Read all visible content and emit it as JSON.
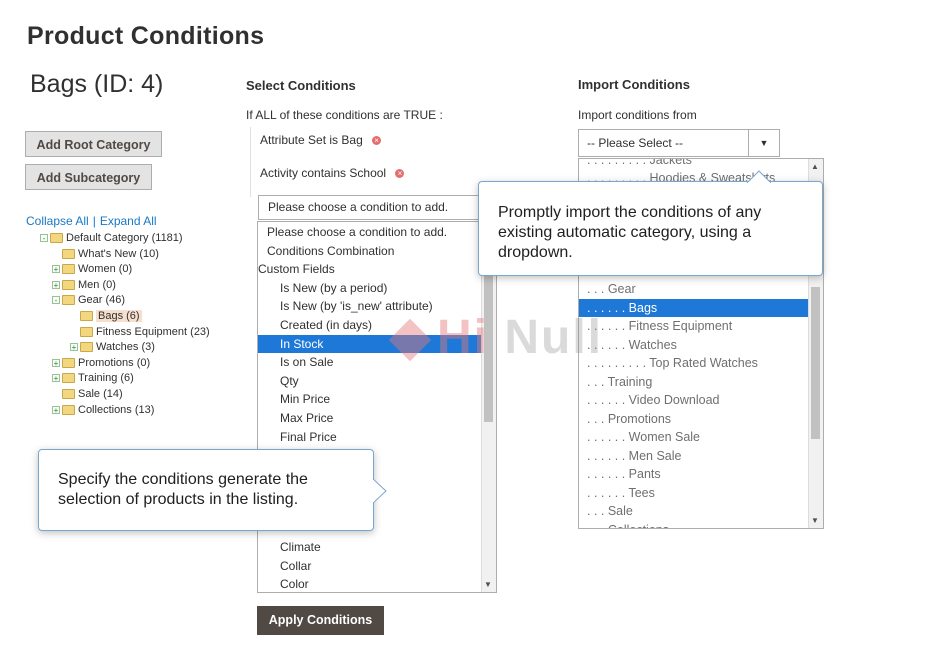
{
  "page": {
    "title": "Product Conditions"
  },
  "category": {
    "heading": "Bags (ID: 4)",
    "add_root_label": "Add Root Category",
    "add_sub_label": "Add Subcategory",
    "collapse_all": "Collapse All",
    "separator": "|",
    "expand_all": "Expand All",
    "tree": [
      {
        "label": "Default Category (1181)",
        "level": 0,
        "toggle": "-",
        "selected": false
      },
      {
        "label": "What's New (10)",
        "level": 1,
        "toggle": "",
        "selected": false
      },
      {
        "label": "Women (0)",
        "level": 1,
        "toggle": "+",
        "selected": false
      },
      {
        "label": "Men (0)",
        "level": 1,
        "toggle": "+",
        "selected": false
      },
      {
        "label": "Gear (46)",
        "level": 1,
        "toggle": "-",
        "selected": false
      },
      {
        "label": "Bags (6)",
        "level": 2,
        "toggle": "",
        "selected": true
      },
      {
        "label": "Fitness Equipment (23)",
        "level": 2,
        "toggle": "",
        "selected": false
      },
      {
        "label": "Watches (3)",
        "level": 2,
        "toggle": "+",
        "selected": false
      },
      {
        "label": "Promotions (0)",
        "level": 1,
        "toggle": "+",
        "selected": false
      },
      {
        "label": "Training (6)",
        "level": 1,
        "toggle": "+",
        "selected": false
      },
      {
        "label": "Sale (14)",
        "level": 1,
        "toggle": "",
        "selected": false
      },
      {
        "label": "Collections (13)",
        "level": 1,
        "toggle": "+",
        "selected": false
      }
    ]
  },
  "conditions": {
    "heading": "Select Conditions",
    "intro_prefix": "If",
    "intro_all": "ALL",
    "intro_mid": "of these conditions are",
    "intro_true": "TRUE",
    "intro_suffix": ":",
    "rule1": {
      "attr": "Attribute Set",
      "op": "is",
      "value": "Bag"
    },
    "rule2": {
      "attr": "Activity",
      "op": "contains",
      "value": "School"
    },
    "select_placeholder": "Please choose a condition to add.",
    "options_top": [
      {
        "label": "Please choose a condition to add.",
        "type": "top"
      },
      {
        "label": "Conditions Combination",
        "type": "top"
      },
      {
        "label": "Custom Fields",
        "type": "group"
      },
      {
        "label": "Is New (by a period)",
        "type": "ind"
      },
      {
        "label": "Is New (by 'is_new' attribute)",
        "type": "ind"
      },
      {
        "label": "Created (in days)",
        "type": "ind"
      },
      {
        "label": "In Stock",
        "type": "ind",
        "hl": true
      },
      {
        "label": "Is on Sale",
        "type": "ind"
      },
      {
        "label": "Qty",
        "type": "ind"
      },
      {
        "label": "Min Price",
        "type": "ind"
      },
      {
        "label": "Max Price",
        "type": "ind"
      },
      {
        "label": "Final Price",
        "type": "ind"
      }
    ],
    "options_bottom": [
      {
        "label": "Climate"
      },
      {
        "label": "Collar"
      },
      {
        "label": "Color"
      }
    ],
    "apply_label": "Apply Conditions"
  },
  "import": {
    "heading": "Import Conditions",
    "label": "Import conditions from",
    "select_value": "-- Please Select --",
    "options": [
      {
        "label": ". . . . . . . . . Jackets"
      },
      {
        "label": ". . . . . . . . . Hoodies & Sweatshirts"
      },
      {
        "label": ". . . Gear"
      },
      {
        "label": ". . . . . . Bags",
        "hl": true
      },
      {
        "label": ". . . . . . Fitness Equipment"
      },
      {
        "label": ". . . . . . Watches"
      },
      {
        "label": ". . . . . . . . . Top Rated Watches"
      },
      {
        "label": ". . . Training"
      },
      {
        "label": ". . . . . . Video Download"
      },
      {
        "label": ". . . Promotions"
      },
      {
        "label": ". . . . . . Women Sale"
      },
      {
        "label": ". . . . . . Men Sale"
      },
      {
        "label": ". . . . . . Pants"
      },
      {
        "label": ". . . . . . Tees"
      },
      {
        "label": ". . . Sale"
      },
      {
        "label": ". . . Collections"
      }
    ]
  },
  "tips": {
    "import_tip": "Promptly import the conditions of any existing automatic category, using a dropdown.",
    "conditions_tip": "Specify the conditions generate the selection of products in the listing."
  },
  "watermark": {
    "part1": "Hi",
    "part2": "Null"
  },
  "colors": {
    "highlight": "#1e78d7",
    "primary_button": "#514943",
    "link": "#1979c3"
  }
}
